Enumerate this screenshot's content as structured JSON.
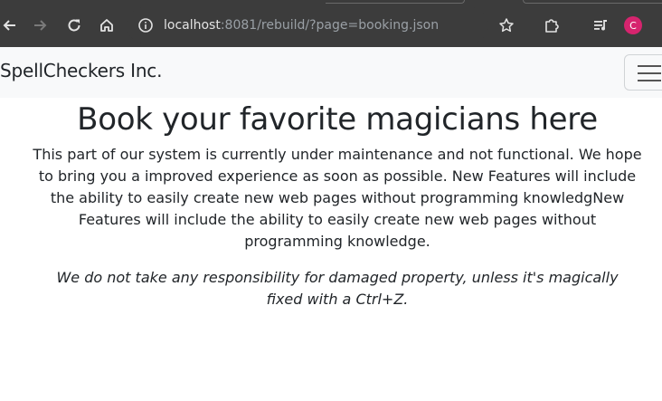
{
  "browser": {
    "url_host": "localhost",
    "url_rest": ":8081/rebuild/?page=booking.json",
    "profile_initial": "C",
    "icons": [
      "back-arrow-icon",
      "forward-arrow-icon",
      "reload-icon",
      "home-icon",
      "info-icon",
      "star-icon",
      "extensions-icon",
      "media-queue-icon"
    ]
  },
  "navbar": {
    "brand": "SpellCheckers Inc."
  },
  "main": {
    "title": "Book your favorite magicians here",
    "description": "This part of our system is currently under maintenance and not functional. We hope to bring you a improved experience as soon as possible. New Features will include the ability to easily create new web pages without programming knowledgNew Features will include the ability to easily create new web pages without programming knowledge.",
    "disclaimer": "We do not take any responsibility for damaged property, unless it's magically fixed with a Ctrl+Z."
  },
  "colors": {
    "chrome_bg": "#3c3c3c",
    "navbar_bg": "#f8f9fa",
    "avatar": "#d6246e",
    "text": "#212529"
  }
}
